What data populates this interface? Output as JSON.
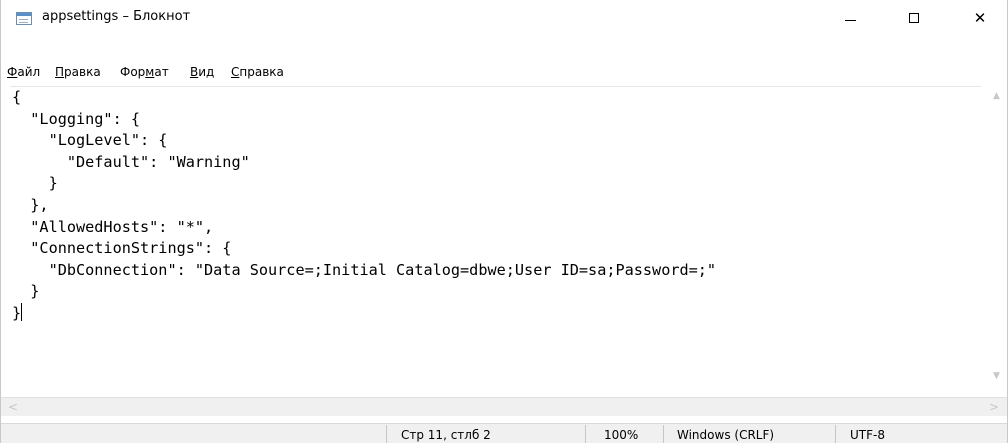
{
  "window": {
    "title": "appsettings – Блокнот",
    "icon": "notepad-icon",
    "controls": {
      "minimize": "minimize-icon",
      "maximize": "maximize-icon",
      "close_glyph": "✕"
    }
  },
  "menu": {
    "items": [
      {
        "label": "Файл",
        "accel": "Ф",
        "rest": "айл"
      },
      {
        "label": "Правка",
        "accel": "П",
        "rest": "равка"
      },
      {
        "label": "Формат",
        "pre": "Фор",
        "accel": "м",
        "rest": "ат"
      },
      {
        "label": "Вид",
        "accel": "В",
        "rest": "ид"
      },
      {
        "label": "Справка",
        "accel": "С",
        "rest": "правка"
      }
    ]
  },
  "editor": {
    "content_before_caret": "{\n  \"Logging\": {\n    \"LogLevel\": {\n      \"Default\": \"Warning\"\n    }\n  },\n  \"AllowedHosts\": \"*\",\n  \"ConnectionStrings\": {\n    \"DbConnection\": \"Data Source=;Initial Catalog=dbwe;User ID=sa;Password=;\"\n  }\n}"
  },
  "scrollbars": {
    "up_arrow": "▲",
    "down_arrow": "▼",
    "left_arrow": "<",
    "right_arrow": ">"
  },
  "status": {
    "position": "Стр 11, стлб 2",
    "zoom": "100%",
    "line_endings": "Windows (CRLF)",
    "encoding": "UTF-8"
  }
}
